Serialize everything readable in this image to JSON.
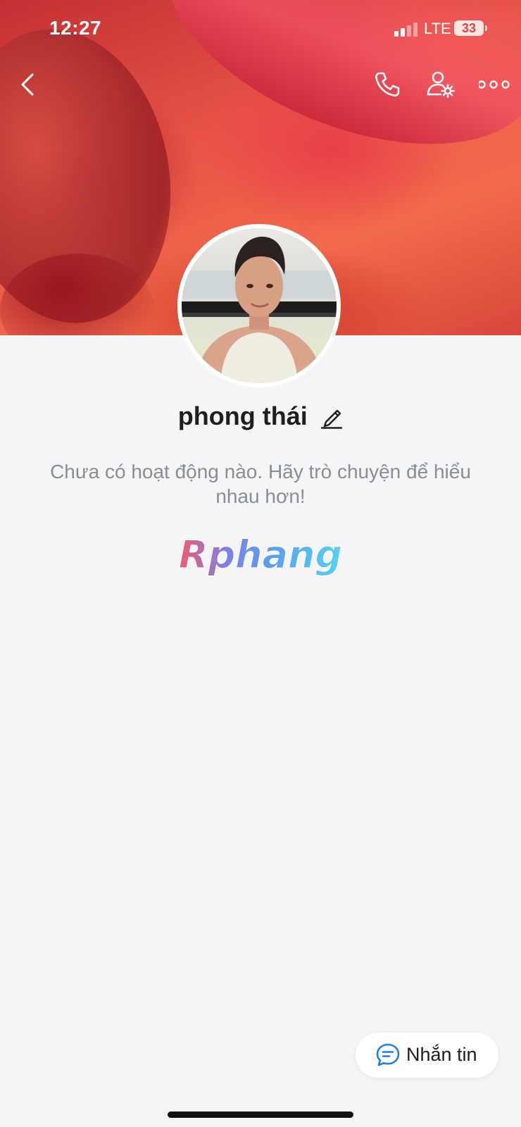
{
  "status_bar": {
    "time": "12:27",
    "network": "LTE",
    "battery": "33"
  },
  "cover": {
    "icons": [
      "back-icon",
      "phone-icon",
      "user-settings-icon",
      "more-icon"
    ]
  },
  "profile": {
    "name": "phong thái",
    "activity_text": "Chưa có hoạt động nào. Hãy trò chuyện để hiểu nhau hơn!",
    "brand_logo": "Rphang"
  },
  "actions": {
    "message_label": "Nhắn tin"
  },
  "colors": {
    "accent": "#1f7ee8",
    "background": "#f4f5f7",
    "name_text": "#1f1f1f",
    "secondary_text": "#8a8d93"
  }
}
